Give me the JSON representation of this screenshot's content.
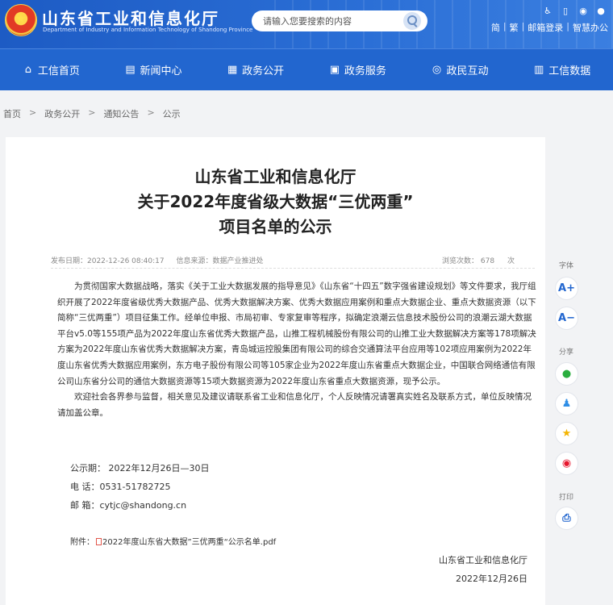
{
  "header": {
    "site_title": "山东省工业和信息化厅",
    "site_subtitle": "Department of Industry and Information Technology of Shandong Province",
    "search_placeholder": "请输入您要搜索的内容",
    "links": [
      "简",
      "繁",
      "邮箱登录",
      "智慧办公"
    ]
  },
  "nav": [
    {
      "label": "工信首页",
      "icon": "home-icon"
    },
    {
      "label": "新闻中心",
      "icon": "news-icon"
    },
    {
      "label": "政务公开",
      "icon": "government-icon"
    },
    {
      "label": "政务服务",
      "icon": "service-icon"
    },
    {
      "label": "政民互动",
      "icon": "interaction-icon"
    },
    {
      "label": "工信数据",
      "icon": "data-icon"
    }
  ],
  "breadcrumb": [
    "首页",
    "政务公开",
    "通知公告",
    "公示"
  ],
  "article": {
    "title_lines": [
      "山东省工业和信息化厅",
      "关于2022年度省级大数据“三优两重”",
      "项目名单的公示"
    ],
    "published": "发布日期：2022-12-26 08:40:17",
    "source": "信息来源：数据产业推进处",
    "views": "浏览次数：  678",
    "views_unit": "次",
    "paragraph1": "为贯彻国家大数据战略，落实《关于工业大数据发展的指导意见》《山东省“十四五”数字强省建设规划》等文件要求，我厅组织开展了2022年度省级优秀大数据产品、优秀大数据解决方案、优秀大数据应用案例和重点大数据企业、重点大数据资源（以下简称“三优两重”）项目征集工作。经单位申报、市局初审、专家复审等程序，拟确定浪潮云信息技术股份公司的浪潮云湖大数据平台v5.0等155项产品为2022年度山东省优秀大数据产品，山推工程机械股份有限公司的山推工业大数据解决方案等178项解决方案为2022年度山东省优秀大数据解决方案，青岛城运控股集团有限公司的综合交通算法平台应用等102项应用案例为2022年度山东省优秀大数据应用案例，东方电子股份有限公司等105家企业为2022年度山东省重点大数据企业，中国联合网络通信有限公司山东省分公司的通信大数据资源等15项大数据资源为2022年度山东省重点大数据资源，现予公示。",
    "paragraph2": "欢迎社会各界参与监督，相关意见及建议请联系省工业和信息化厅，个人反映情况请署真实姓名及联系方式，单位反映情况请加盖公章。",
    "period": "公示期：  2022年12月26日—30日",
    "phone": "电    话：0531-51782725",
    "email": "邮    箱：cytjc@shandong.cn",
    "attachment_label": "附件：",
    "attachment_name": "2022年度山东省大数据”三优两重“公示名单.pdf",
    "signature": "山东省工业和信息化厅",
    "date": "2022年12月26日"
  },
  "sidebar": {
    "font_label": "字体",
    "font_increase": "A+",
    "font_decrease": "A−",
    "share_label": "分享",
    "print_label": "打印"
  }
}
